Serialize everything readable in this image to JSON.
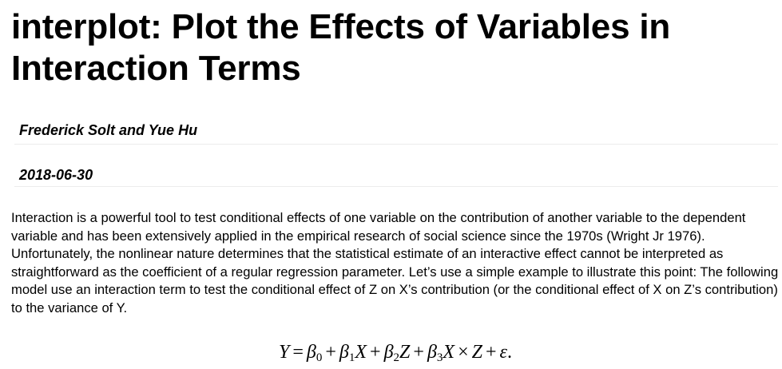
{
  "document": {
    "title": "interplot: Plot the Effects of Variables in Interaction Terms",
    "author": "Frederick Solt and Yue Hu",
    "date": "2018-06-30",
    "paragraph": "Interaction is a powerful tool to test conditional effects of one variable on the contribution of another variable to the dependent variable and has been extensively applied in the empirical research of social science since the 1970s (Wright Jr 1976). Unfortunately, the nonlinear nature determines that the statistical estimate of an interactive effect cannot be interpreted as straightforward as the coefficient of a regular regression parameter. Let’s use a simple example to illustrate this point: The following model use an interaction term to test the conditional effect of Z on X’s contribution (or the conditional effect of X on Z’s contribution) to the variance of Y.",
    "equation": {
      "lhs": "Y",
      "eq": "=",
      "beta": "β",
      "plus": "+",
      "times": "×",
      "X": "X",
      "Z": "Z",
      "epsilon": "ε",
      "end": ".",
      "sub0": "0",
      "sub1": "1",
      "sub2": "2",
      "sub3": "3"
    }
  }
}
